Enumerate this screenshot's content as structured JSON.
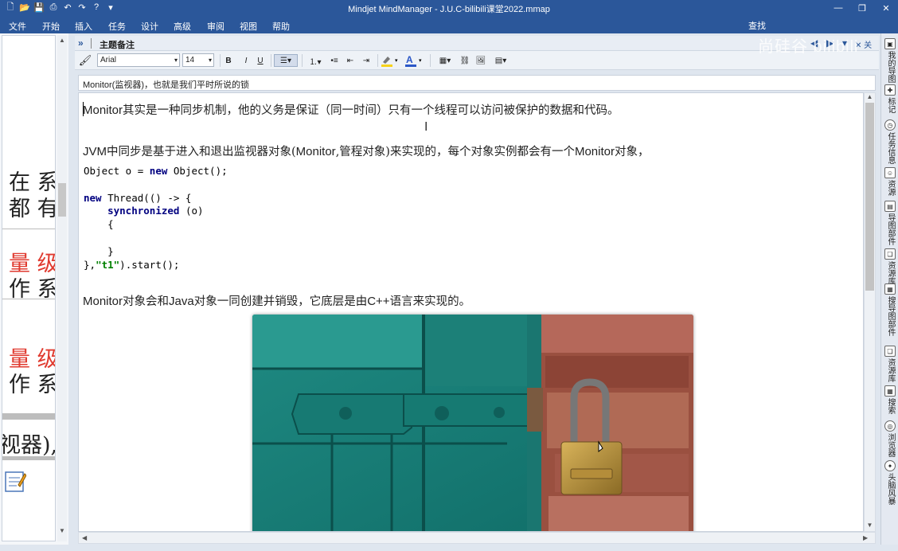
{
  "window": {
    "title": "Mindjet MindManager - J.U.C-bilibili课堂2022.mmap"
  },
  "menu": {
    "items": [
      "文件",
      "开始",
      "插入",
      "任务",
      "设计",
      "高级",
      "审阅",
      "视图",
      "帮助"
    ],
    "search_label": "查找",
    "watermark": "尚硅谷 bilibili"
  },
  "left_canvas": {
    "lines": [
      {
        "text": "在 系",
        "color": "#222222"
      },
      {
        "text": "都 有",
        "color": "#222222"
      },
      {
        "text": "量 级",
        "color": "#e03a2f"
      },
      {
        "text": "作 系",
        "color": "#222222"
      },
      {
        "text": "量 级",
        "color": "#e03a2f"
      },
      {
        "text": "作 系",
        "color": "#222222"
      },
      {
        "text": "视器),",
        "color": "#222222"
      }
    ],
    "note_icon": "notes-icon"
  },
  "notes_panel": {
    "title": "主题备注",
    "close_label": "关闭",
    "font_family_value": "Arial",
    "font_size_value": "14",
    "subject_line": "Monitor(监视器)，也就是我们平时所说的锁"
  },
  "toolbar": {
    "bold": "B",
    "italic": "I",
    "underline": "U",
    "text_color": "#2b57c7",
    "highlight_color": "#f7d21a"
  },
  "content": {
    "para1_en": "Monitor",
    "para1_cn": "其实是一种同步机制，他的义务是保证（同一时间）只有一个线程可以访问被保护的数据和代码。",
    "para2": {
      "a": "JVM",
      "b": "中同步是基于进入和退出监视器对象(",
      "c": "Monitor",
      "d": ",管程对象)来实现的，每个对象实例都会有一个",
      "e": "Monitor",
      "f": "对象，"
    },
    "code": {
      "line1": "Object o = ",
      "kw_new": "new",
      "line1b": " Object();",
      "kw_new2": "new",
      "line3": " Thread(() -> {",
      "kw_sync": "synchronized",
      "line4": " (o)",
      "line5": "    {",
      "line7": "    }",
      "line8a": "},",
      "str_t1": "\"t1\"",
      "line8b": ").start();"
    },
    "para3": {
      "a": "Monitor",
      "b": "对象会和",
      "c": "Java",
      "d": "对象一同创建并销毁，它底层是由",
      "e": "C++",
      "f": "语言来实现的。"
    },
    "image_alt": "padlock on green door"
  },
  "right_sidebar": [
    {
      "label": "我的导图",
      "icon": "my-maps-icon"
    },
    {
      "label": "标记",
      "icon": "markers-icon"
    },
    {
      "label": "任务信息",
      "icon": "task-info-icon"
    },
    {
      "label": "资源",
      "icon": "resources-icon"
    },
    {
      "label": "导图部件",
      "icon": "map-parts-icon"
    },
    {
      "label": "资源库",
      "icon": "library-icon"
    },
    {
      "label": "搜导图部件",
      "icon": "search-map-parts-icon"
    },
    {
      "label": "资源库",
      "icon": "library2-icon"
    },
    {
      "label": "搜索",
      "icon": "search-icon"
    },
    {
      "label": "浏览器",
      "icon": "browser-icon"
    },
    {
      "label": "头脑风暴",
      "icon": "brainstorm-icon"
    }
  ]
}
